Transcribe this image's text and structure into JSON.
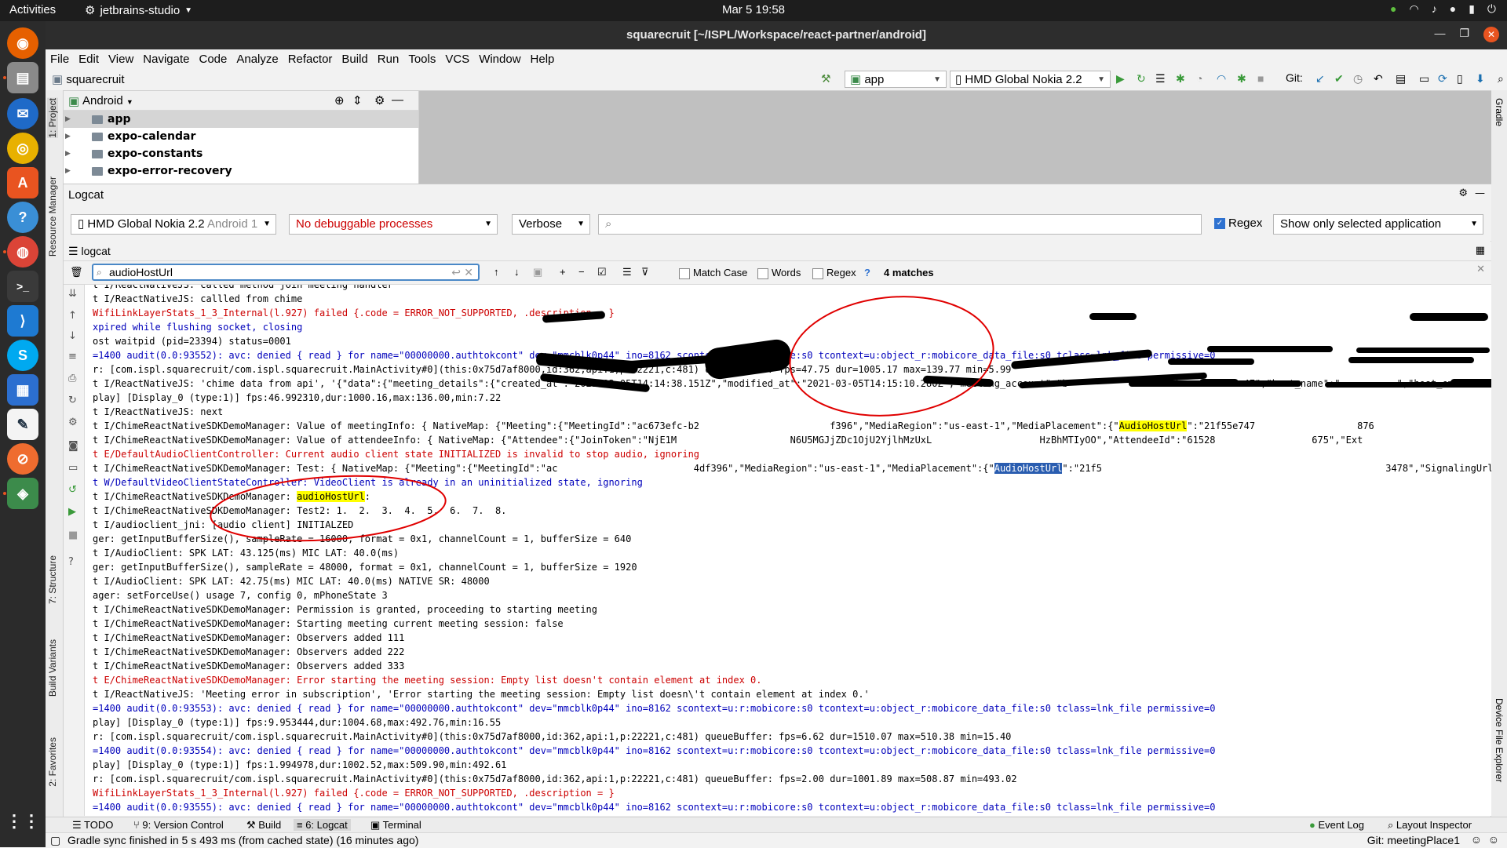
{
  "topbar": {
    "activities": "Activities",
    "app_name": "jetbrains-studio",
    "clock": "Mar 5  19:58"
  },
  "window": {
    "title": "squarecruit [~/ISPL/Workspace/react-partner/android]"
  },
  "menu": [
    "File",
    "Edit",
    "View",
    "Navigate",
    "Code",
    "Analyze",
    "Refactor",
    "Build",
    "Run",
    "Tools",
    "VCS",
    "Window",
    "Help"
  ],
  "navbar": {
    "breadcrumb": "squarecruit",
    "run_config": "app",
    "device": "HMD Global Nokia 2.2",
    "git_label": "Git:"
  },
  "side_tabs": {
    "left": [
      "1: Project",
      "Resource Manager",
      "7: Structure",
      "Build Variants",
      "2: Favorites"
    ],
    "right": [
      "Gradle",
      "Device File Explorer"
    ]
  },
  "project": {
    "view": "Android",
    "items": [
      "app",
      "expo-calendar",
      "expo-constants",
      "expo-error-recovery"
    ]
  },
  "logcat": {
    "title": "Logcat",
    "device_name": "HMD Global Nokia 2.2",
    "device_android": "Android 1",
    "process": "No debuggable processes",
    "level": "Verbose",
    "search_placeholder": "",
    "regex_label": "Regex",
    "regex_checked": true,
    "app_filter": "Show only selected application",
    "tab_label": "logcat",
    "find_query": "audioHostUrl",
    "match_case": "Match Case",
    "words": "Words",
    "find_regex": "Regex",
    "help": "?",
    "matches": "4 matches",
    "lines": [
      {
        "t": "i",
        "s": "t I/ReactNativeJS: called method join meeting handler"
      },
      {
        "t": "i",
        "s": "t I/ReactNativeJS: callled from chime"
      },
      {
        "t": "e",
        "s": "WifiLinkLayerStats_1_3_Internal(l.927) failed {.code = ERROR_NOT_SUPPORTED, .description = }"
      },
      {
        "t": "w",
        "s": "xpired while flushing socket, closing"
      },
      {
        "t": "i",
        "s": "ost waitpid (pid=23394) status=0001"
      },
      {
        "t": "w",
        "s": "=1400 audit(0.0:93552): avc: denied { read } for name=\"00000000.authtokcont\" dev=\"mmcblk0p44\" ino=8162 scontext=u:r:mobicore:s0 tcontext=u:object_r:mobicore_data_file:s0 tclass=lnk_file permissive=0"
      },
      {
        "t": "i",
        "s": "r: [com.ispl.squarecruit/com.ispl.squarecruit.MainActivity#0](this:0x75d7af8000,id:362,api:1,p:22221,c:481) queueBuffer: fps=47.75 dur=1005.17 max=139.77 min=5.99"
      },
      {
        "t": "i",
        "s": "t I/ReactNativeJS: 'chime data from api', '{\"data\":{\"meeting_details\":{\"created_at\":\"2021-03-05T14:14:38.151Z\",\"modified_at\":\"2021-03-05T14:15:10.280Z\",\"meeting_account\":\"b                 e-b        15a47\",\"host_name\":\"          \",\"host_email\":\"         "
      },
      {
        "t": "i",
        "s": "play] [Display_0 (type:1)] fps:46.992310,dur:1000.16,max:136.00,min:7.22"
      },
      {
        "t": "i",
        "s": "t I/ReactNativeJS: next"
      },
      {
        "t": "i",
        "s": "t I/ChimeReactNativeSDKDemoManager: Value of meetingInfo: { NativeMap: {\"Meeting\":{\"MeetingId\":\"ac673efc-b2                       f396\",\"MediaRegion\":\"us-east-1\",\"MediaPlacement\":{\"",
        "hl": "AudioHostUrl",
        "after": "\":\"21f55e747                  876                            8"
      },
      {
        "t": "i",
        "s": "t I/ChimeReactNativeSDKDemoManager: Value of attendeeInfo: { NativeMap: {\"Attendee\":{\"JoinToken\":\"NjE1M                    N6U5MGJjZDc1OjU2YjlhMzUxL                   HzBhMTIyOO\",\"AttendeeId\":\"61528                 675\",\"Ext"
      },
      {
        "t": "e",
        "s": "t E/DefaultAudioClientController: Current audio client state INITIALIZED is invalid to stop audio, ignoring"
      },
      {
        "t": "i",
        "s": "t I/ChimeReactNativeSDKDemoManager: Test: { NativeMap: {\"Meeting\":{\"MeetingId\":\"ac                        4df396\",\"MediaRegion\":\"us-east-1\",\"MediaPlacement\":{\"",
        "hlsel": "AudioHostUrl",
        "after": "\":\"21f5                                                  3478\",\"SignalingUrl\""
      },
      {
        "t": "w",
        "s": "t W/DefaultVideoClientStateController: VideoClient is already in an uninitialized state, ignoring"
      },
      {
        "t": "i",
        "s": "t I/ChimeReactNativeSDKDemoManager: ",
        "hl": "audioHostUrl",
        "after": ":"
      },
      {
        "t": "i",
        "s": "t I/ChimeReactNativeSDKDemoManager: Test2: 1.  2.  3.  4.  5.  6.  7.  8."
      },
      {
        "t": "i",
        "s": "t I/audioclient_jni: [audio client] INITIALZED"
      },
      {
        "t": "i",
        "s": "ger: getInputBufferSize(), sampleRate = 16000, format = 0x1, channelCount = 1, bufferSize = 640"
      },
      {
        "t": "i",
        "s": "t I/AudioClient: SPK LAT: 43.125(ms) MIC LAT: 40.0(ms)"
      },
      {
        "t": "i",
        "s": "ger: getInputBufferSize(), sampleRate = 48000, format = 0x1, channelCount = 1, bufferSize = 1920"
      },
      {
        "t": "i",
        "s": "t I/AudioClient: SPK LAT: 42.75(ms) MIC LAT: 40.0(ms) NATIVE SR: 48000"
      },
      {
        "t": "i",
        "s": "ager: setForceUse() usage 7, config 0, mPhoneState 3"
      },
      {
        "t": "i",
        "s": "t I/ChimeReactNativeSDKDemoManager: Permission is granted, proceeding to starting meeting"
      },
      {
        "t": "i",
        "s": "t I/ChimeReactNativeSDKDemoManager: Starting meeting current meeting session: false"
      },
      {
        "t": "i",
        "s": "t I/ChimeReactNativeSDKDemoManager: Observers added 111"
      },
      {
        "t": "i",
        "s": "t I/ChimeReactNativeSDKDemoManager: Observers added 222"
      },
      {
        "t": "i",
        "s": "t I/ChimeReactNativeSDKDemoManager: Observers added 333"
      },
      {
        "t": "e",
        "s": "t E/ChimeReactNativeSDKDemoManager: Error starting the meeting session: Empty list doesn't contain element at index 0."
      },
      {
        "t": "i",
        "s": "t I/ReactNativeJS: 'Meeting error in subscription', 'Error starting the meeting session: Empty list doesn\\'t contain element at index 0.'"
      },
      {
        "t": "w",
        "s": "=1400 audit(0.0:93553): avc: denied { read } for name=\"00000000.authtokcont\" dev=\"mmcblk0p44\" ino=8162 scontext=u:r:mobicore:s0 tcontext=u:object_r:mobicore_data_file:s0 tclass=lnk_file permissive=0"
      },
      {
        "t": "i",
        "s": "play] [Display_0 (type:1)] fps:9.953444,dur:1004.68,max:492.76,min:16.55"
      },
      {
        "t": "i",
        "s": "r: [com.ispl.squarecruit/com.ispl.squarecruit.MainActivity#0](this:0x75d7af8000,id:362,api:1,p:22221,c:481) queueBuffer: fps=6.62 dur=1510.07 max=510.38 min=15.40"
      },
      {
        "t": "w",
        "s": "=1400 audit(0.0:93554): avc: denied { read } for name=\"00000000.authtokcont\" dev=\"mmcblk0p44\" ino=8162 scontext=u:r:mobicore:s0 tcontext=u:object_r:mobicore_data_file:s0 tclass=lnk_file permissive=0"
      },
      {
        "t": "i",
        "s": "play] [Display_0 (type:1)] fps:1.994978,dur:1002.52,max:509.90,min:492.61"
      },
      {
        "t": "i",
        "s": "r: [com.ispl.squarecruit/com.ispl.squarecruit.MainActivity#0](this:0x75d7af8000,id:362,api:1,p:22221,c:481) queueBuffer: fps=2.00 dur=1001.89 max=508.87 min=493.02"
      },
      {
        "t": "e",
        "s": "WifiLinkLayerStats_1_3_Internal(l.927) failed {.code = ERROR_NOT_SUPPORTED, .description = }"
      },
      {
        "t": "w",
        "s": "=1400 audit(0.0:93555): avc: denied { read } for name=\"00000000.authtokcont\" dev=\"mmcblk0p44\" ino=8162 scontext=u:r:mobicore:s0 tcontext=u:object_r:mobicore_data_file:s0 tclass=lnk_file permissive=0"
      }
    ]
  },
  "bottom_tabs": [
    "TODO",
    "9: Version Control",
    "Build",
    "6: Logcat",
    "Terminal"
  ],
  "bottom_right_tabs": [
    "Event Log",
    "Layout Inspector"
  ],
  "status": {
    "message": "Gradle sync finished in 5 s 493 ms (from cached state) (16 minutes ago)",
    "git_branch": "Git: meetingPlace1"
  },
  "colors": {
    "error": "#cc0000",
    "warn": "#0000bb",
    "highlight": "#ffff00",
    "selection": "#2a5db0",
    "annotation": "#e00000"
  }
}
